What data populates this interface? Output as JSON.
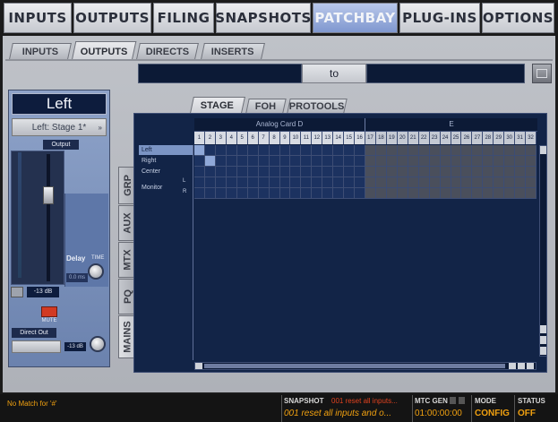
{
  "top_tabs": [
    {
      "label": "INPUTS"
    },
    {
      "label": "OUTPUTS"
    },
    {
      "label": "FILING"
    },
    {
      "label": "SNAPSHOTS"
    },
    {
      "label": "PATCHBAY",
      "active": true
    },
    {
      "label": "PLUG-INS"
    },
    {
      "label": "OPTIONS"
    }
  ],
  "sub_tabs": [
    {
      "label": "INPUTS"
    },
    {
      "label": "OUTPUTS",
      "active": true
    },
    {
      "label": "DIRECTS"
    },
    {
      "label": "INSERTS"
    }
  ],
  "range": {
    "from_value": "",
    "to_label": "to",
    "to_value": ""
  },
  "channel_strip": {
    "name": "Left",
    "selector": "Left: Stage 1*",
    "output_label": "Output",
    "output_value": "-13 dB",
    "mute_label": "MUTE",
    "delay_label": "Delay",
    "time_label": "TIME",
    "delay_value": "0.0 ms",
    "direct_out_label": "Direct Out",
    "direct_out_value": "-13 dB"
  },
  "grid_tabs": [
    {
      "label": "STAGE",
      "active": true
    },
    {
      "label": "FOH"
    },
    {
      "label": "PROTOOLS"
    }
  ],
  "grid": {
    "card_d_label": "Analog Card D",
    "card_e_label": "E",
    "channel_numbers": [
      "1",
      "2",
      "3",
      "4",
      "5",
      "6",
      "7",
      "8",
      "9",
      "10",
      "11",
      "12",
      "13",
      "14",
      "15",
      "16",
      "17",
      "18",
      "19",
      "20",
      "21",
      "22",
      "23",
      "24",
      "25",
      "26",
      "27",
      "28",
      "29",
      "30",
      "31",
      "32"
    ],
    "rows": [
      {
        "label": "Left",
        "selected": true
      },
      {
        "label": "Right"
      },
      {
        "label": "Center"
      },
      {
        "label": "Monitor",
        "sub": "L"
      },
      {
        "label": "",
        "sub": "R"
      }
    ]
  },
  "side_tabs": [
    "GRP",
    "AUX",
    "MTX",
    "PQ",
    "MAINS"
  ],
  "status_bar": {
    "message": "No Match for '#'",
    "snapshot_label": "SNAPSHOT",
    "snapshot_current": "001 reset all inputs...",
    "snapshot_detail": "001 reset all inputs and o...",
    "mtc_label": "MTC GEN",
    "mtc_value": "01:00:00:00",
    "mode_label": "MODE",
    "mode_value": "CONFIG",
    "status_label": "STATUS",
    "status_value": "OFF"
  },
  "colors": {
    "accent": "#f0a010",
    "active_tab": "#8aa0d6",
    "grid_bg": "#122447"
  }
}
